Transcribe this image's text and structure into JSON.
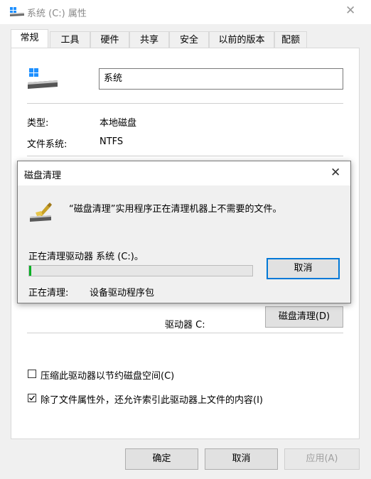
{
  "window": {
    "title": "系统 (C:) 属性",
    "close_glyph": "✕"
  },
  "tabs": [
    {
      "label": "常规",
      "active": true
    },
    {
      "label": "工具"
    },
    {
      "label": "硬件"
    },
    {
      "label": "共享"
    },
    {
      "label": "安全"
    },
    {
      "label": "以前的版本"
    },
    {
      "label": "配额"
    }
  ],
  "general": {
    "drive_name": "系统",
    "type_label": "类型:",
    "type_value": "本地磁盘",
    "fs_label": "文件系统:",
    "fs_value": "NTFS",
    "drive_label": "驱动器 C:",
    "disk_cleanup_button": "磁盘清理(D)",
    "compress_label": "压缩此驱动器以节约磁盘空间(C)",
    "compress_checked": false,
    "index_label": "除了文件属性外，还允许索引此驱动器上文件的内容(I)",
    "index_checked": true
  },
  "footer": {
    "ok": "确定",
    "cancel": "取消",
    "apply": "应用(A)"
  },
  "cleanup_dialog": {
    "title": "磁盘清理",
    "close_glyph": "✕",
    "message": "“磁盘清理”实用程序正在清理机器上不需要的文件。",
    "status": "正在清理驱动器 系统 (C:)。",
    "progress": 0.01,
    "cleaning_label": "正在清理:",
    "cleaning_item": "设备驱动程序包",
    "cancel": "取消"
  },
  "colors": {
    "progress_fill": "#06b025",
    "focus_border": "#0078d7"
  }
}
